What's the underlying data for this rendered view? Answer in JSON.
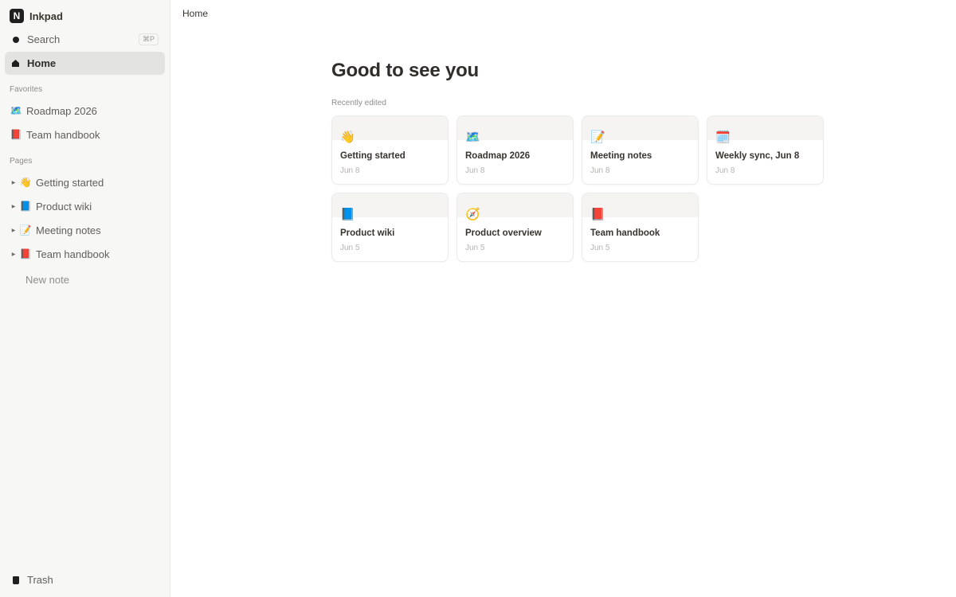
{
  "workspace": {
    "logo_letter": "N",
    "name": "Inkpad"
  },
  "nav": {
    "search": {
      "label": "Search",
      "shortcut": "⌘P",
      "icon": "dot-icon"
    },
    "home": {
      "label": "Home",
      "icon": "house-icon"
    }
  },
  "favorites": {
    "heading": "Favorites",
    "items": [
      {
        "emoji": "🗺️",
        "icon": "map-icon",
        "label": "Roadmap 2026"
      },
      {
        "emoji": "📕",
        "icon": "red-book-icon",
        "label": "Team handbook"
      }
    ]
  },
  "pages": {
    "heading": "Pages",
    "items": [
      {
        "emoji": "👋",
        "icon": "wave-icon",
        "label": "Getting started"
      },
      {
        "emoji": "📘",
        "icon": "blue-book-icon",
        "label": "Product wiki"
      },
      {
        "emoji": "📝",
        "icon": "memo-icon",
        "label": "Meeting notes"
      },
      {
        "emoji": "📕",
        "icon": "red-book-icon",
        "label": "Team handbook"
      }
    ],
    "new_note": "New note"
  },
  "trash": {
    "label": "Trash",
    "icon": "trash-icon"
  },
  "breadcrumb": "Home",
  "main": {
    "greeting": "Good to see you",
    "recent_label": "Recently edited",
    "cards": [
      {
        "emoji": "👋",
        "icon": "wave-icon",
        "title": "Getting started",
        "date": "Jun 8"
      },
      {
        "emoji": "🗺️",
        "icon": "map-icon",
        "title": "Roadmap 2026",
        "date": "Jun 8"
      },
      {
        "emoji": "📝",
        "icon": "memo-icon",
        "title": "Meeting notes",
        "date": "Jun 8"
      },
      {
        "emoji": "🗓️",
        "icon": "calendar-icon",
        "title": "Weekly sync, Jun 8",
        "date": "Jun 8"
      },
      {
        "emoji": "📘",
        "icon": "blue-book-icon",
        "title": "Product wiki",
        "date": "Jun 5"
      },
      {
        "emoji": "🧭",
        "icon": "compass-icon",
        "title": "Product overview",
        "date": "Jun 5"
      },
      {
        "emoji": "📕",
        "icon": "red-book-icon",
        "title": "Team handbook",
        "date": "Jun 5"
      }
    ]
  },
  "colors": {
    "sidebar_bg": "#f7f7f5",
    "active_row_bg": "#e3e3e1",
    "text": "#37352f",
    "muted": "#8f8e8a",
    "card_border": "#ebebea",
    "card_cover": "#f5f4f2"
  }
}
